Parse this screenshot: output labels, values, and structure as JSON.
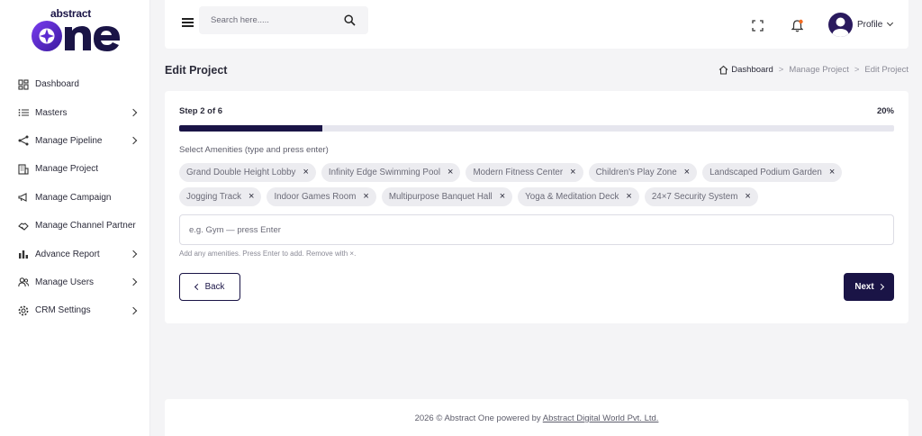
{
  "brand": {
    "top_word": "abstract",
    "logo_text": "one"
  },
  "sidebar": {
    "items": [
      {
        "label": "Dashboard",
        "icon": "dashboard-grid-icon",
        "has_chevron": false
      },
      {
        "label": "Masters",
        "icon": "list-icon",
        "has_chevron": true
      },
      {
        "label": "Manage Pipeline",
        "icon": "share-nodes-icon",
        "has_chevron": true
      },
      {
        "label": "Manage Project",
        "icon": "building-icon",
        "has_chevron": false
      },
      {
        "label": "Manage Campaign",
        "icon": "megaphone-icon",
        "has_chevron": false
      },
      {
        "label": "Manage Channel Partner",
        "icon": "handshake-icon",
        "has_chevron": false
      },
      {
        "label": "Advance Report",
        "icon": "bar-chart-icon",
        "has_chevron": true
      },
      {
        "label": "Manage Users",
        "icon": "users-icon",
        "has_chevron": true
      },
      {
        "label": "CRM Settings",
        "icon": "gear-icon",
        "has_chevron": true
      }
    ]
  },
  "topbar": {
    "search_placeholder": "Search here.....",
    "profile_label": "Profile"
  },
  "page": {
    "title": "Edit Project",
    "breadcrumb": [
      "Dashboard",
      "Manage Project",
      "Edit Project"
    ],
    "breadcrumb_sep": ">"
  },
  "wizard": {
    "step_text": "Step 2 of 6",
    "percent_text": "20%",
    "progress_fraction": 0.2,
    "amenities_label": "Select Amenities (type and press enter)",
    "amenities": [
      "Grand Double Height Lobby",
      "Infinity Edge Swimming Pool",
      "Modern Fitness Center",
      "Children's Play Zone",
      "Landscaped Podium Garden",
      "Jogging Track",
      "Indoor Games Room",
      "Multipurpose Banquet Hall",
      "Yoga & Meditation Deck",
      "24×7 Security System"
    ],
    "remove_symbol": "×",
    "input_placeholder": "e.g. Gym — press Enter",
    "hint": "Add any amenities. Press Enter to add. Remove with ×.",
    "back_label": "Back",
    "next_label": "Next"
  },
  "footer": {
    "prefix": "2026 © Abstract One powered by ",
    "link_text": "Abstract Digital World Pvt. Ltd."
  },
  "colors": {
    "brand_dark": "#1a1446",
    "brand_purple": "#5b2bd1",
    "notification_dot": "#f26b21",
    "background": "#f4f4f6"
  }
}
